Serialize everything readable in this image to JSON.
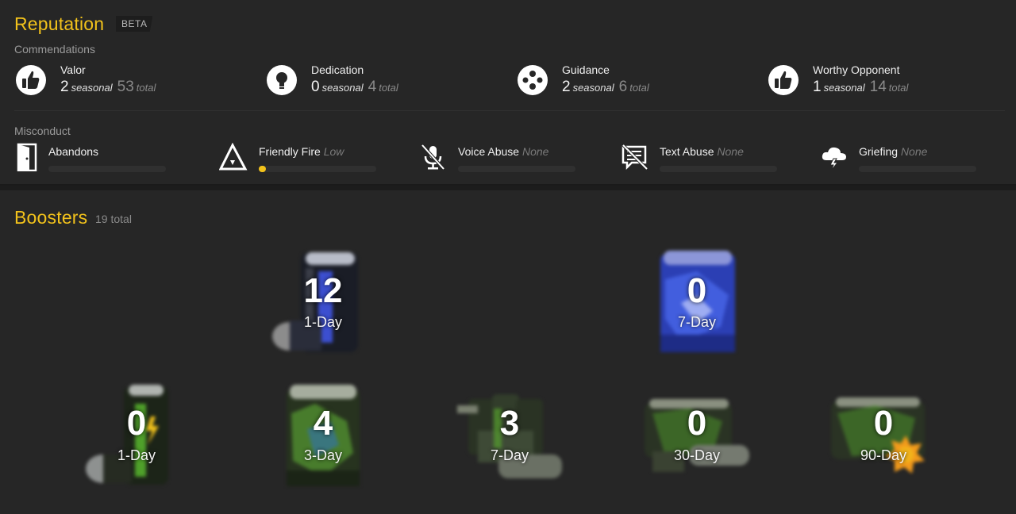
{
  "reputation": {
    "title": "Reputation",
    "badge": "BETA",
    "commendations_heading": "Commendations",
    "commendations": [
      {
        "name": "Valor",
        "seasonal": "2",
        "seasonal_label": "seasonal",
        "total": "53",
        "total_label": "total",
        "icon": "thumbs-up-icon"
      },
      {
        "name": "Dedication",
        "seasonal": "0",
        "seasonal_label": "seasonal",
        "total": "4",
        "total_label": "total",
        "icon": "lightbulb-icon"
      },
      {
        "name": "Guidance",
        "seasonal": "2",
        "seasonal_label": "seasonal",
        "total": "6",
        "total_label": "total",
        "icon": "group-icon"
      },
      {
        "name": "Worthy Opponent",
        "seasonal": "1",
        "seasonal_label": "seasonal",
        "total": "14",
        "total_label": "total",
        "icon": "thumbs-up-icon"
      }
    ],
    "misconduct_heading": "Misconduct",
    "misconduct": [
      {
        "name": "Abandons",
        "level": "",
        "level_fraction": 0,
        "icon": "door-icon"
      },
      {
        "name": "Friendly Fire",
        "level": "Low",
        "level_fraction": 0.06,
        "icon": "triangle-icon"
      },
      {
        "name": "Voice Abuse",
        "level": "None",
        "level_fraction": 0,
        "icon": "muted-mic-icon"
      },
      {
        "name": "Text Abuse",
        "level": "None",
        "level_fraction": 0,
        "icon": "crossed-message-icon"
      },
      {
        "name": "Griefing",
        "level": "None",
        "level_fraction": 0,
        "icon": "storm-cloud-icon"
      }
    ]
  },
  "boosters": {
    "title": "Boosters",
    "total": "19 total",
    "items": [
      {
        "count": "12",
        "duration": "1-Day"
      },
      {
        "count": "0",
        "duration": "7-Day"
      },
      {
        "count": "0",
        "duration": "1-Day"
      },
      {
        "count": "4",
        "duration": "3-Day"
      },
      {
        "count": "3",
        "duration": "7-Day"
      },
      {
        "count": "0",
        "duration": "30-Day"
      },
      {
        "count": "0",
        "duration": "90-Day"
      }
    ]
  },
  "colors": {
    "accent": "#f2c21b",
    "panel": "#262626",
    "background": "#1c1c1c"
  }
}
